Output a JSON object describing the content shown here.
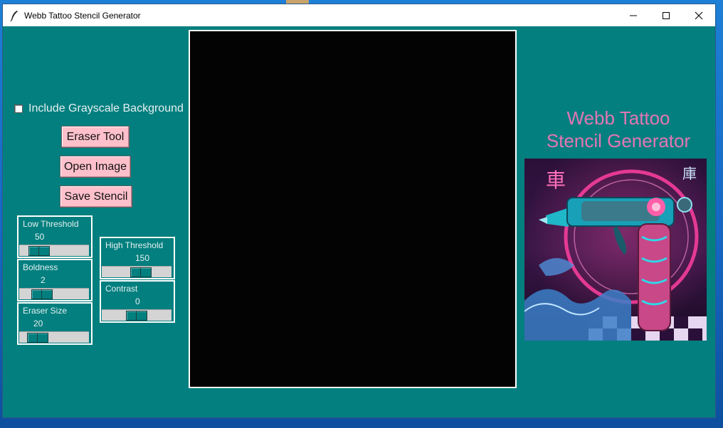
{
  "window": {
    "title": "Webb Tattoo Stencil Generator"
  },
  "controls": {
    "grayscale_checkbox_label": "Include Grayscale Background",
    "grayscale_checked": false,
    "eraser_button": "Eraser Tool",
    "open_button": "Open Image",
    "save_button": "Save Stencil"
  },
  "sliders": {
    "low_threshold": {
      "label": "Low Threshold",
      "value": "50"
    },
    "boldness": {
      "label": "Boldness",
      "value": "2"
    },
    "eraser_size": {
      "label": "Eraser Size",
      "value": "20"
    },
    "high_threshold": {
      "label": "High Threshold",
      "value": "150"
    },
    "contrast": {
      "label": "Contrast",
      "value": "0"
    }
  },
  "branding": {
    "line1": "Webb Tattoo",
    "line2": "Stencil Generator"
  },
  "colors": {
    "background": "#037f7f",
    "button": "#ffc0cb",
    "brand_text": "#e376b4"
  }
}
